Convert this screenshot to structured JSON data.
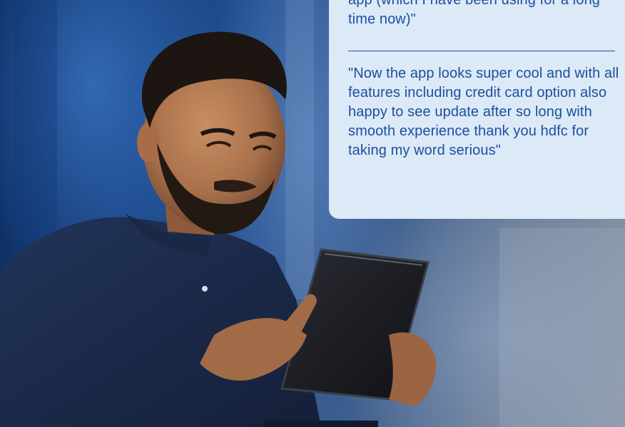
{
  "testimonials": {
    "quote_1": "app (which I have been using for a long time now)\"",
    "quote_2": "\"Now the app looks super cool and with all features including credit card option also happy to see update after so long with smooth experience thank you hdfc for taking my word serious\""
  },
  "photo": {
    "subject": "man-using-tablet",
    "palette": {
      "shirt": "#1b2a48",
      "skin": "#b27a55",
      "hair": "#1d1511",
      "tablet": "#1a1b20"
    }
  },
  "colors": {
    "card_bg": "#dce9f7",
    "text": "#1d4f9d"
  }
}
